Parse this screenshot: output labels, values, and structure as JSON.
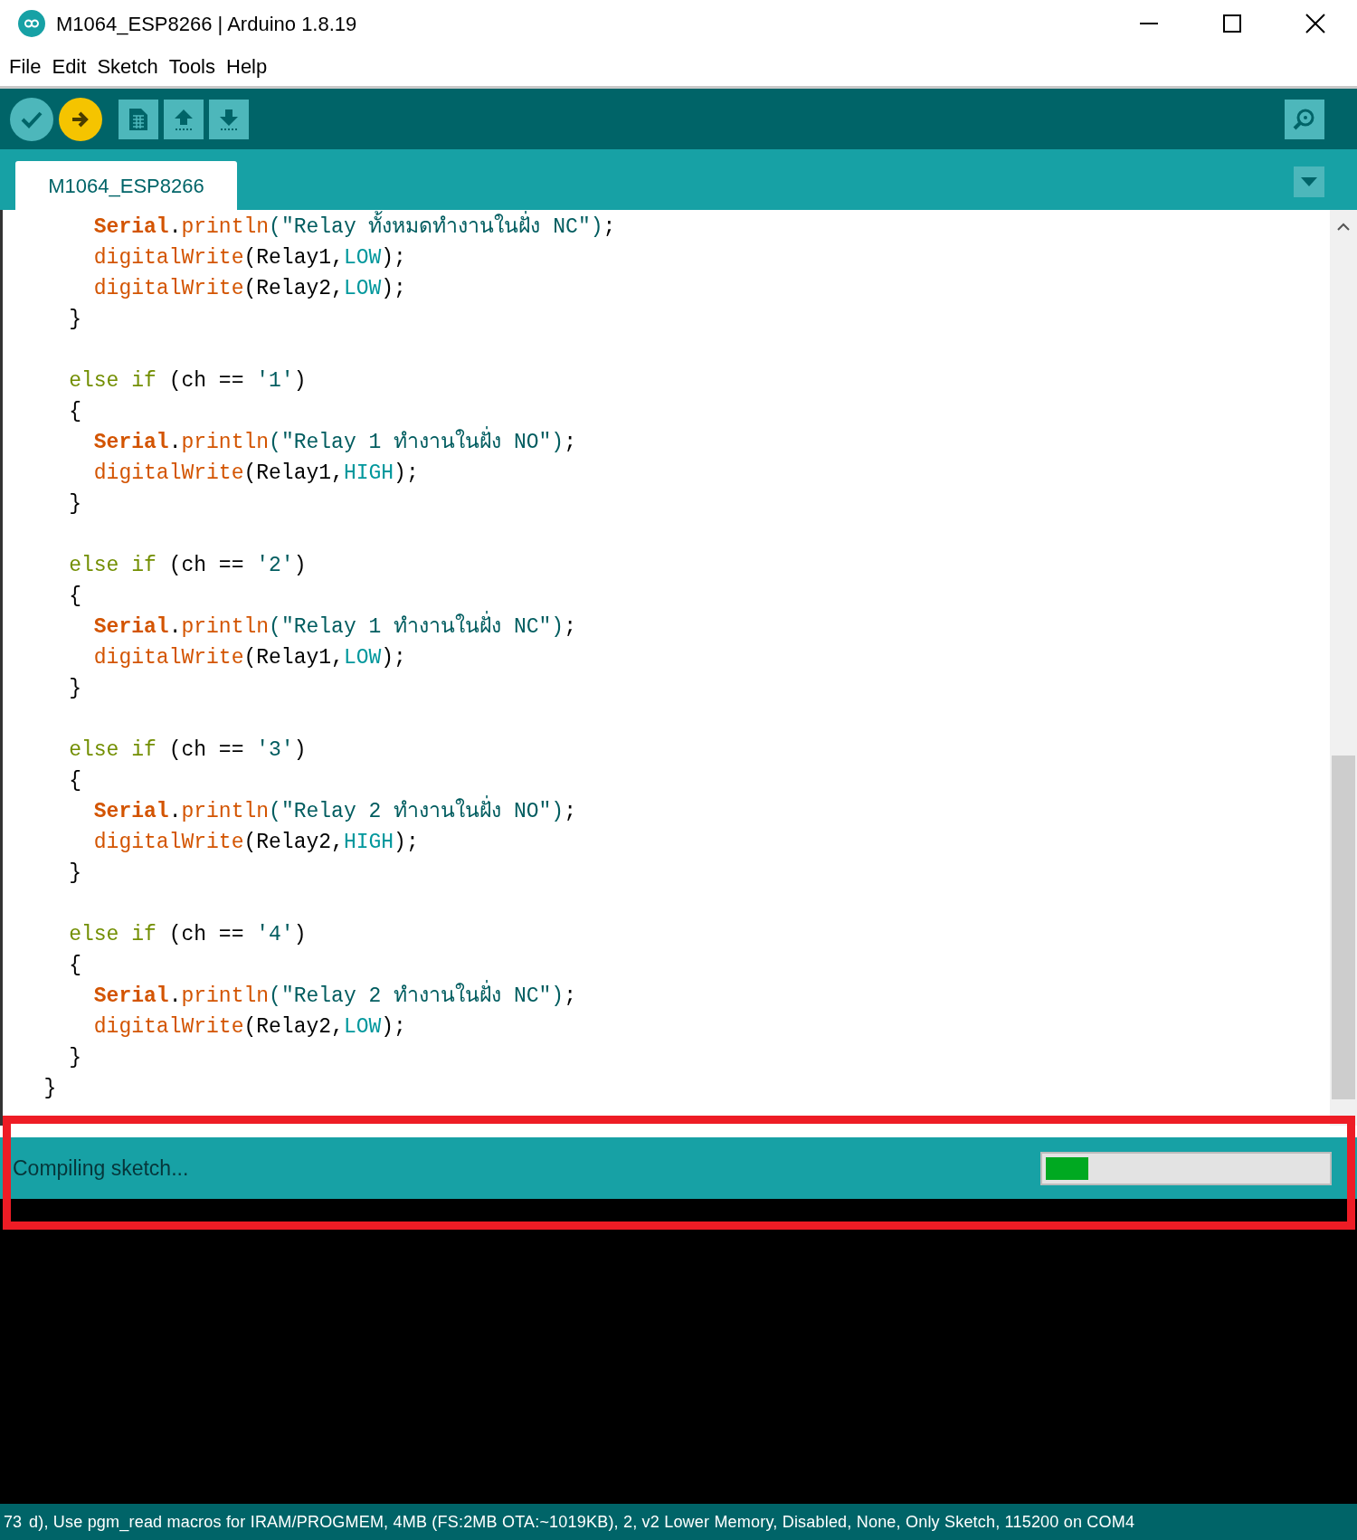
{
  "window": {
    "title": "M1064_ESP8266 | Arduino 1.8.19"
  },
  "menu": [
    "File",
    "Edit",
    "Sketch",
    "Tools",
    "Help"
  ],
  "tabs": [
    {
      "label": "M1064_ESP8266",
      "selected": true
    }
  ],
  "code": [
    {
      "kind": "code",
      "tokens": [
        {
          "t": "      Serial",
          "kind": "class"
        },
        {
          "t": ".",
          "kind": "plain"
        },
        {
          "t": "println",
          "kind": "func"
        },
        {
          "t": "(\"Relay ทั้งหมดทำงานในฝั่ง NC\")",
          "kind": "string"
        },
        {
          "t": ";",
          "kind": "plain"
        }
      ]
    },
    {
      "kind": "code",
      "tokens": [
        {
          "t": "      digitalWrite",
          "kind": "func"
        },
        {
          "t": "(Relay1,",
          "kind": "plain"
        },
        {
          "t": "LOW",
          "kind": "const"
        },
        {
          "t": ");",
          "kind": "plain"
        }
      ]
    },
    {
      "kind": "code",
      "tokens": [
        {
          "t": "      digitalWrite",
          "kind": "func"
        },
        {
          "t": "(Relay2,",
          "kind": "plain"
        },
        {
          "t": "LOW",
          "kind": "const"
        },
        {
          "t": ");",
          "kind": "plain"
        }
      ]
    },
    {
      "kind": "code",
      "tokens": [
        {
          "t": "    }",
          "kind": "plain"
        }
      ]
    },
    {
      "kind": "blank"
    },
    {
      "kind": "code",
      "tokens": [
        {
          "t": "    else if",
          "kind": "keyword"
        },
        {
          "t": " (ch == ",
          "kind": "plain"
        },
        {
          "t": "'1'",
          "kind": "string"
        },
        {
          "t": ")",
          "kind": "plain"
        }
      ]
    },
    {
      "kind": "code",
      "tokens": [
        {
          "t": "    {",
          "kind": "plain"
        }
      ]
    },
    {
      "kind": "code",
      "tokens": [
        {
          "t": "      Serial",
          "kind": "class"
        },
        {
          "t": ".",
          "kind": "plain"
        },
        {
          "t": "println",
          "kind": "func"
        },
        {
          "t": "(\"Relay 1 ทำงานในฝั่ง NO\")",
          "kind": "string"
        },
        {
          "t": ";",
          "kind": "plain"
        }
      ]
    },
    {
      "kind": "code",
      "tokens": [
        {
          "t": "      digitalWrite",
          "kind": "func"
        },
        {
          "t": "(Relay1,",
          "kind": "plain"
        },
        {
          "t": "HIGH",
          "kind": "const"
        },
        {
          "t": ");",
          "kind": "plain"
        }
      ]
    },
    {
      "kind": "code",
      "tokens": [
        {
          "t": "    }",
          "kind": "plain"
        }
      ]
    },
    {
      "kind": "blank"
    },
    {
      "kind": "code",
      "tokens": [
        {
          "t": "    else if",
          "kind": "keyword"
        },
        {
          "t": " (ch == ",
          "kind": "plain"
        },
        {
          "t": "'2'",
          "kind": "string"
        },
        {
          "t": ")",
          "kind": "plain"
        }
      ]
    },
    {
      "kind": "code",
      "tokens": [
        {
          "t": "    {",
          "kind": "plain"
        }
      ]
    },
    {
      "kind": "code",
      "tokens": [
        {
          "t": "      Serial",
          "kind": "class"
        },
        {
          "t": ".",
          "kind": "plain"
        },
        {
          "t": "println",
          "kind": "func"
        },
        {
          "t": "(\"Relay 1 ทำงานในฝั่ง NC\")",
          "kind": "string"
        },
        {
          "t": ";",
          "kind": "plain"
        }
      ]
    },
    {
      "kind": "code",
      "tokens": [
        {
          "t": "      digitalWrite",
          "kind": "func"
        },
        {
          "t": "(Relay1,",
          "kind": "plain"
        },
        {
          "t": "LOW",
          "kind": "const"
        },
        {
          "t": ");",
          "kind": "plain"
        }
      ]
    },
    {
      "kind": "code",
      "tokens": [
        {
          "t": "    }",
          "kind": "plain"
        }
      ]
    },
    {
      "kind": "blank"
    },
    {
      "kind": "code",
      "tokens": [
        {
          "t": "    else if",
          "kind": "keyword"
        },
        {
          "t": " (ch == ",
          "kind": "plain"
        },
        {
          "t": "'3'",
          "kind": "string"
        },
        {
          "t": ")",
          "kind": "plain"
        }
      ]
    },
    {
      "kind": "code",
      "tokens": [
        {
          "t": "    {",
          "kind": "plain"
        }
      ]
    },
    {
      "kind": "code",
      "tokens": [
        {
          "t": "      Serial",
          "kind": "class"
        },
        {
          "t": ".",
          "kind": "plain"
        },
        {
          "t": "println",
          "kind": "func"
        },
        {
          "t": "(\"Relay 2 ทำงานในฝั่ง NO\")",
          "kind": "string"
        },
        {
          "t": ";",
          "kind": "plain"
        }
      ]
    },
    {
      "kind": "code",
      "tokens": [
        {
          "t": "      digitalWrite",
          "kind": "func"
        },
        {
          "t": "(Relay2,",
          "kind": "plain"
        },
        {
          "t": "HIGH",
          "kind": "const"
        },
        {
          "t": ");",
          "kind": "plain"
        }
      ]
    },
    {
      "kind": "code",
      "tokens": [
        {
          "t": "    }",
          "kind": "plain"
        }
      ]
    },
    {
      "kind": "blank"
    },
    {
      "kind": "code",
      "tokens": [
        {
          "t": "    else if",
          "kind": "keyword"
        },
        {
          "t": " (ch == ",
          "kind": "plain"
        },
        {
          "t": "'4'",
          "kind": "string"
        },
        {
          "t": ")",
          "kind": "plain"
        }
      ]
    },
    {
      "kind": "code",
      "tokens": [
        {
          "t": "    {",
          "kind": "plain"
        }
      ]
    },
    {
      "kind": "code",
      "tokens": [
        {
          "t": "      Serial",
          "kind": "class"
        },
        {
          "t": ".",
          "kind": "plain"
        },
        {
          "t": "println",
          "kind": "func"
        },
        {
          "t": "(\"Relay 2 ทำงานในฝั่ง NC\")",
          "kind": "string"
        },
        {
          "t": ";",
          "kind": "plain"
        }
      ]
    },
    {
      "kind": "code",
      "tokens": [
        {
          "t": "      digitalWrite",
          "kind": "func"
        },
        {
          "t": "(Relay2,",
          "kind": "plain"
        },
        {
          "t": "LOW",
          "kind": "const"
        },
        {
          "t": ");",
          "kind": "plain"
        }
      ]
    },
    {
      "kind": "code",
      "tokens": [
        {
          "t": "    }",
          "kind": "plain"
        }
      ]
    },
    {
      "kind": "code",
      "tokens": [
        {
          "t": "  }",
          "kind": "plain"
        }
      ]
    }
  ],
  "status": {
    "message": "Compiling sketch...",
    "level": 0.15
  },
  "footer": {
    "line_number": "73",
    "board": "d), Use pgm_read macros for IRAM/PROGMEM, 4MB (FS:2MB OTA:~1019KB), 2, v2 Lower Memory, Disabled, None, Only Sketch, 115200 on COM4"
  }
}
